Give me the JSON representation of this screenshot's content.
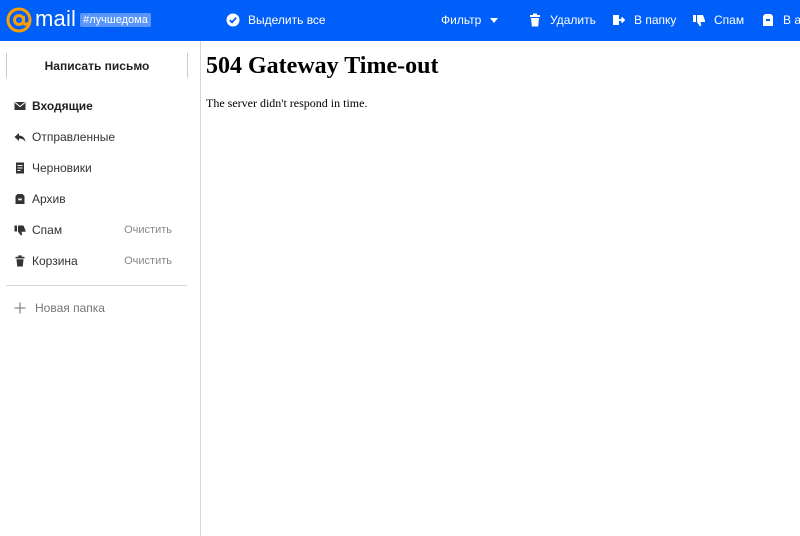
{
  "header": {
    "logo_text": "mail",
    "logo_tag": "#лучшедома",
    "toolbar": {
      "select_all": "Выделить все",
      "filter": "Фильтр",
      "delete": "Удалить",
      "move": "В папку",
      "spam": "Спам",
      "archive": "В ар"
    },
    "colors": {
      "bar": "#005ff9",
      "text": "#ffffff",
      "logo_at": "#ff9e00"
    }
  },
  "sidebar": {
    "compose_label": "Написать письмо",
    "folders": [
      {
        "label": "Входящие",
        "icon": "envelope-icon",
        "active": true
      },
      {
        "label": "Отправленные",
        "icon": "reply-icon"
      },
      {
        "label": "Черновики",
        "icon": "draft-icon"
      },
      {
        "label": "Архив",
        "icon": "archive-icon"
      },
      {
        "label": "Спам",
        "icon": "thumbs-down-icon",
        "clear_label": "Очистить"
      },
      {
        "label": "Корзина",
        "icon": "trash-icon",
        "clear_label": "Очистить"
      }
    ],
    "new_folder_label": "Новая папка"
  },
  "content": {
    "title": "504 Gateway Time-out",
    "message": "The server didn't respond in time."
  }
}
